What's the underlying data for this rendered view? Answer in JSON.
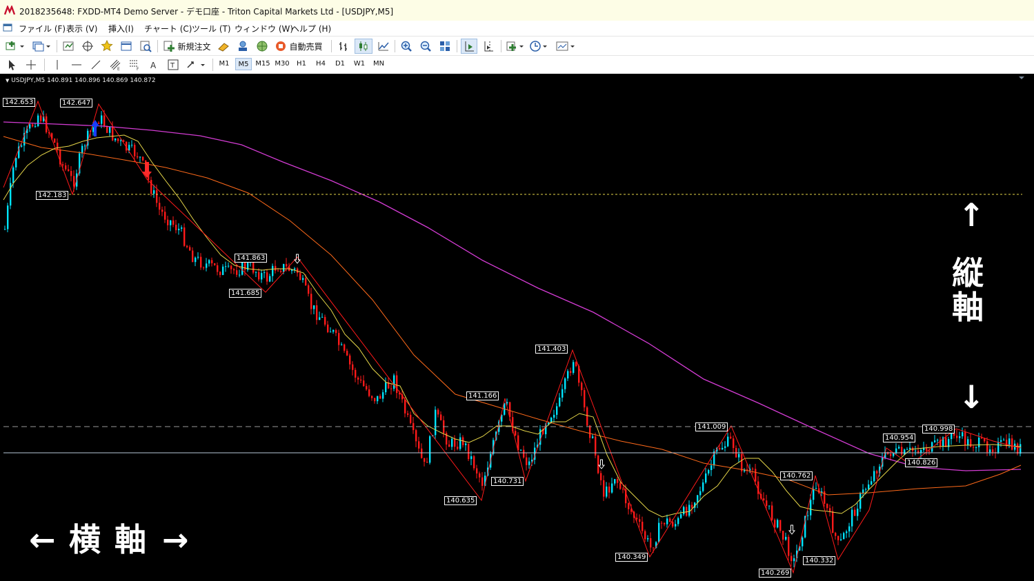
{
  "window": {
    "title": "2018235648: FXDD-MT4 Demo Server - デモ口座 - Triton Capital Markets Ltd - [USDJPY,M5]"
  },
  "menu": [
    "ファイル (F)",
    "表示 (V)",
    "挿入(I)",
    "チャート (C)",
    "ツール (T)",
    "ウィンドウ (W)",
    "ヘルプ (H)"
  ],
  "toolbar": {
    "new_order": "新規注文",
    "auto_trade": "自動売買"
  },
  "timeframes": [
    "M1",
    "M5",
    "M15",
    "M30",
    "H1",
    "H4",
    "D1",
    "W1",
    "MN"
  ],
  "active_timeframe": "M5",
  "chart": {
    "symbol_line": "USDJPY,M5  140.891 140.896 140.869 140.872",
    "price_labels": [
      "142.653",
      "142.647",
      "142.183",
      "141.863",
      "141.685",
      "141.403",
      "141.166",
      "140.731",
      "140.635",
      "141.009",
      "140.349",
      "140.762",
      "140.269",
      "140.332",
      "140.954",
      "140.998",
      "140.826"
    ],
    "colors": {
      "bull": "#00e5ff",
      "bear": "#ff1a1a",
      "ma_fast": "#e8d84a",
      "ma_mid": "#ff6a1a",
      "ma_slow": "#d43cd4",
      "zigzag": "#ff1a1a",
      "dotted_level": "#e8d84a"
    }
  },
  "annotations": {
    "vertical_axis": "縦軸",
    "horizontal_axis": "横軸",
    "arrow_up": "↑",
    "arrow_down": "↓",
    "arrow_left": "←",
    "arrow_right": "→"
  }
}
